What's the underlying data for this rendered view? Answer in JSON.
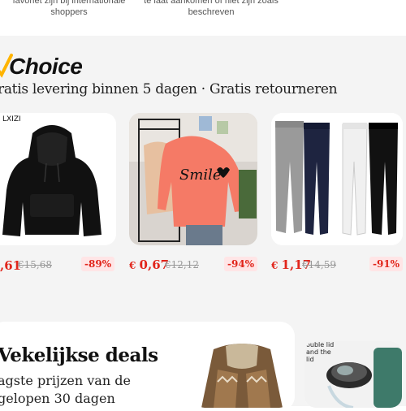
{
  "top_strip": {
    "left_text": "favoriet zijn bij internationale shoppers",
    "right_text": "te laat aankomen of niet zijn zoals beschreven"
  },
  "choice": {
    "title": "Choice",
    "subtitle": "ratis levering binnen 5 dagen · Gratis retourneren",
    "accent_color": "#ffb400",
    "products": [
      {
        "name": "black hoodie",
        "brand_tag": "LXIZI",
        "price_main": ",61",
        "price_old": "€15,68",
        "discount": "-89%"
      },
      {
        "name": "pink smile hoodie",
        "price_prefix": "€ ",
        "price_main": "0,67",
        "price_old": "€12,12",
        "discount": "-94%"
      },
      {
        "name": "sweatpants set",
        "price_prefix": "€ ",
        "price_main": "1,17",
        "price_old": "€14,59",
        "discount": "-91%"
      }
    ]
  },
  "deals": {
    "title": "Vekelijkse deals",
    "subtitle": "agste prijzen van de gelopen 30 dagen",
    "products": [
      {
        "name": "fur trimmed jacket"
      },
      {
        "name": "insulated bottle",
        "caption": "ouble lid and the lid"
      }
    ]
  },
  "colors": {
    "price_red": "#e1251b",
    "discount_bg": "#ffe5e6",
    "band_bg": "#f4f4f4"
  }
}
